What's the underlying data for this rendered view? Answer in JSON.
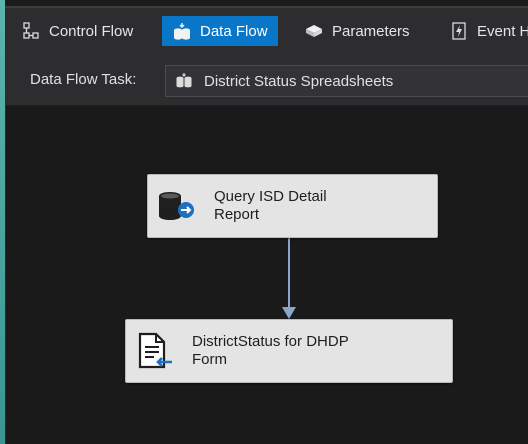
{
  "tabs": [
    {
      "label": "Control Flow",
      "icon": "control-flow-icon",
      "active": false
    },
    {
      "label": "Data Flow",
      "icon": "data-flow-icon",
      "active": true
    },
    {
      "label": "Parameters",
      "icon": "parameters-icon",
      "active": false
    },
    {
      "label": "Event H",
      "icon": "event-handlers-icon",
      "active": false
    }
  ],
  "task": {
    "label": "Data Flow Task:",
    "value": "District Status Spreadsheets",
    "icon": "data-flow-task-icon"
  },
  "nodes": {
    "source": {
      "label_line1": "Query ISD Detail",
      "label_line2": "Report",
      "icon": "ole-db-source-icon"
    },
    "destination": {
      "label_line1": "DistrictStatus for DHDP",
      "label_line2": "Form",
      "icon": "flat-file-destination-icon"
    }
  },
  "colors": {
    "accent": "#0a76c8",
    "connector": "#8aa6c8",
    "canvas": "#1a1a1a",
    "toolbar": "#2d2d30"
  }
}
